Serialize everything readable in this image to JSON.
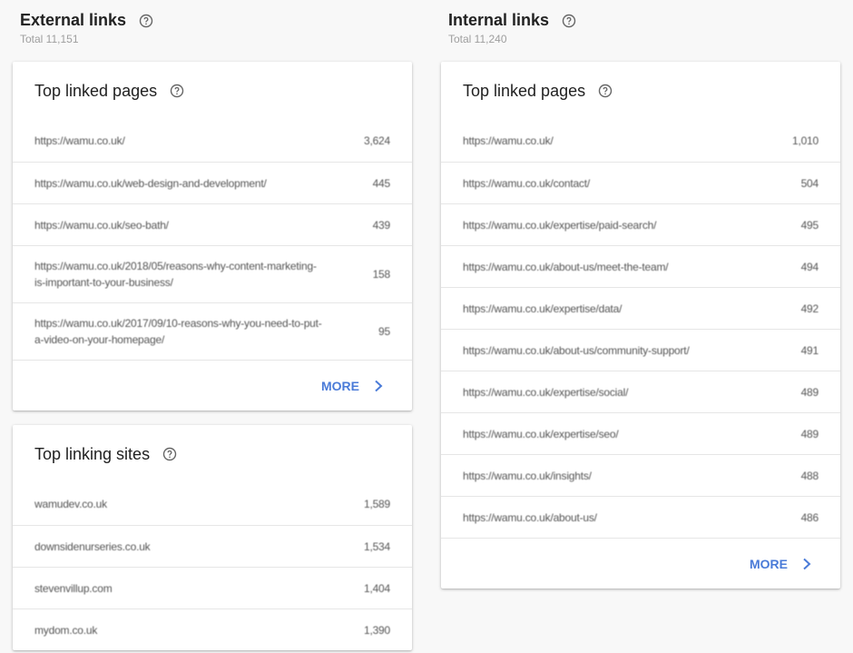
{
  "external": {
    "title": "External links",
    "total": "Total 11,151",
    "top_linked_pages": {
      "title": "Top linked pages",
      "rows": [
        {
          "url": "https://wamu.co.uk/",
          "count": "3,624",
          "tall": false
        },
        {
          "url": "https://wamu.co.uk/web-design-and-development/",
          "count": "445",
          "tall": false
        },
        {
          "url": "https://wamu.co.uk/seo-bath/",
          "count": "439",
          "tall": false
        },
        {
          "url": "https://wamu.co.uk/2018/05/reasons-why-content-marketing-is-important-to-your-business/",
          "count": "158",
          "tall": true
        },
        {
          "url": "https://wamu.co.uk/2017/09/10-reasons-why-you-need-to-put-a-video-on-your-homepage/",
          "count": "95",
          "tall": true
        }
      ],
      "more_label": "MORE"
    },
    "top_linking_sites": {
      "title": "Top linking sites",
      "rows": [
        {
          "url": "wamudev.co.uk",
          "count": "1,589"
        },
        {
          "url": "downsidenurseries.co.uk",
          "count": "1,534"
        },
        {
          "url": "stevenvillup.com",
          "count": "1,404"
        },
        {
          "url": "mydom.co.uk",
          "count": "1,390"
        }
      ]
    }
  },
  "internal": {
    "title": "Internal links",
    "total": "Total 11,240",
    "top_linked_pages": {
      "title": "Top linked pages",
      "rows": [
        {
          "url": "https://wamu.co.uk/",
          "count": "1,010"
        },
        {
          "url": "https://wamu.co.uk/contact/",
          "count": "504"
        },
        {
          "url": "https://wamu.co.uk/expertise/paid-search/",
          "count": "495"
        },
        {
          "url": "https://wamu.co.uk/about-us/meet-the-team/",
          "count": "494"
        },
        {
          "url": "https://wamu.co.uk/expertise/data/",
          "count": "492"
        },
        {
          "url": "https://wamu.co.uk/about-us/community-support/",
          "count": "491"
        },
        {
          "url": "https://wamu.co.uk/expertise/social/",
          "count": "489"
        },
        {
          "url": "https://wamu.co.uk/expertise/seo/",
          "count": "489"
        },
        {
          "url": "https://wamu.co.uk/insights/",
          "count": "488"
        },
        {
          "url": "https://wamu.co.uk/about-us/",
          "count": "486"
        }
      ],
      "more_label": "MORE"
    }
  },
  "colors": {
    "accent": "#4a7bd8",
    "background": "#f8f8f8",
    "divider": "#e6e6e6"
  }
}
